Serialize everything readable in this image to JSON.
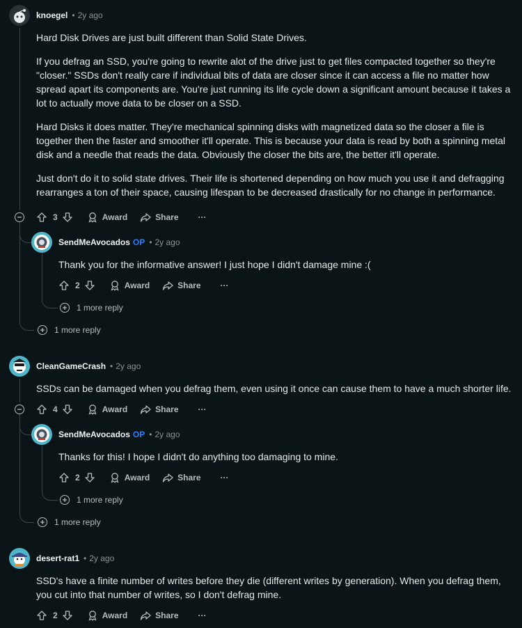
{
  "comments": [
    {
      "author": "knoegel",
      "time": "2y ago",
      "paragraphs": [
        "Hard Disk Drives are just built different than Solid State Drives.",
        "If you defrag an SSD, you're going to rewrite alot of the drive just to get files compacted together so they're \"closer.\" SSDs don't really care if individual bits of data are closer since it can access a file no matter how spread apart its components are. You're just running its life cycle down a significant amount because it takes a lot to actually move data to be closer on a SSD.",
        "Hard Disks it does matter. They're mechanical spinning disks with magnetized data so the closer a file is together then the faster and smoother it'll operate. This is because your data is read by both a spinning metal disk and a needle that reads the data. Obviously the closer the bits are, the better it'll operate.",
        "Just don't do it to solid state drives. Their life is shortened depending on how much you use it and defragging rearranges a ton of their space, causing lifespan to be decreased drastically for no change in performance."
      ],
      "votes": "3",
      "more_reply": "1 more reply",
      "reply": {
        "author": "SendMeAvocados",
        "op": "OP",
        "time": "2y ago",
        "text": "Thank you for the informative answer! I just hope I didn't damage mine :(",
        "votes": "2",
        "more_reply": "1 more reply"
      }
    },
    {
      "author": "CleanGameCrash",
      "time": "2y ago",
      "paragraphs": [
        "SSDs can be damaged when you defrag them, even using it once can cause them to have a much shorter life."
      ],
      "votes": "4",
      "more_reply": "1 more reply",
      "reply": {
        "author": "SendMeAvocados",
        "op": "OP",
        "time": "2y ago",
        "text": "Thanks for this! I hope I didn't do anything too damaging to mine.",
        "votes": "2",
        "more_reply": "1 more reply"
      }
    },
    {
      "author": "desert-rat1",
      "time": "2y ago",
      "paragraphs": [
        "SSD's have a finite number of writes before they die (different writes by generation). When you defrag them, you cut into that number of writes, so I don't defrag mine."
      ],
      "votes": "2"
    }
  ],
  "actions": {
    "award": "Award",
    "share": "Share",
    "more": "···"
  },
  "icons": {
    "upvote": "arrow-up-icon",
    "downvote": "arrow-down-icon",
    "award": "award-icon",
    "share": "share-icon",
    "expand": "plus-circle-icon",
    "collapse": "minus-circle-icon"
  },
  "colors": {
    "background": "#0b1416",
    "op": "#2f7ef7",
    "text": "#e8eaec",
    "muted": "#8a9396"
  }
}
